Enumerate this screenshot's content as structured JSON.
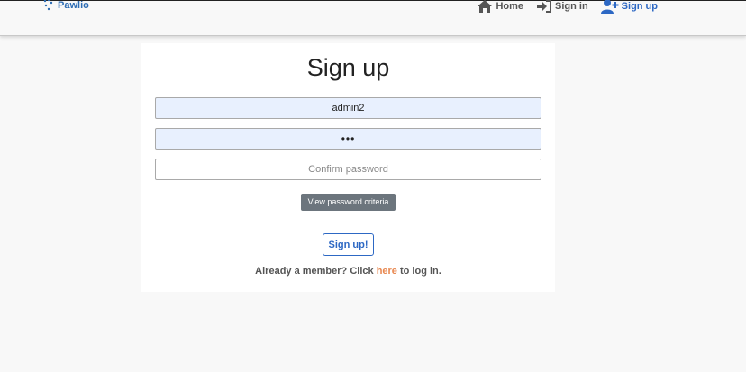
{
  "navbar": {
    "brand": "Pawlio",
    "links": [
      {
        "label": "Home",
        "icon": "home-icon"
      },
      {
        "label": "Sign in",
        "icon": "sign-in-icon"
      },
      {
        "label": "Sign up",
        "icon": "add-user-icon",
        "active": true
      }
    ]
  },
  "form": {
    "title": "Sign up",
    "username": {
      "value": "admin2"
    },
    "password": {
      "value": "•••"
    },
    "confirm": {
      "placeholder": "Confirm password",
      "value": ""
    },
    "criteria_label": "View password criteria",
    "submit_label": "Sign up!",
    "member_prefix": "Already a member? Click ",
    "member_link": "here",
    "member_suffix": " to log in."
  },
  "colors": {
    "accent": "#2d68c4",
    "link": "#e8874f",
    "autofill": "#e8f0fe",
    "secondary_button": "#6c757d"
  }
}
